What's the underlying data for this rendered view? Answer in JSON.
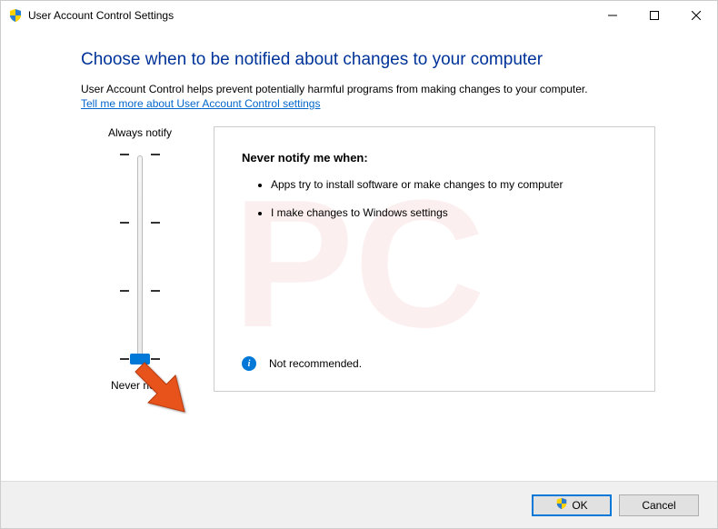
{
  "titlebar": {
    "title": "User Account Control Settings"
  },
  "heading": "Choose when to be notified about changes to your computer",
  "description": "User Account Control helps prevent potentially harmful programs from making changes to your computer.",
  "link": "Tell me more about User Account Control settings",
  "slider": {
    "top_label": "Always notify",
    "bottom_label": "Never notify",
    "levels": 4,
    "current_level": 0
  },
  "panel": {
    "title": "Never notify me when:",
    "bullets": [
      "Apps try to install software or make changes to my computer",
      "I make changes to Windows settings"
    ],
    "recommendation": "Not recommended."
  },
  "buttons": {
    "ok": "OK",
    "cancel": "Cancel"
  }
}
